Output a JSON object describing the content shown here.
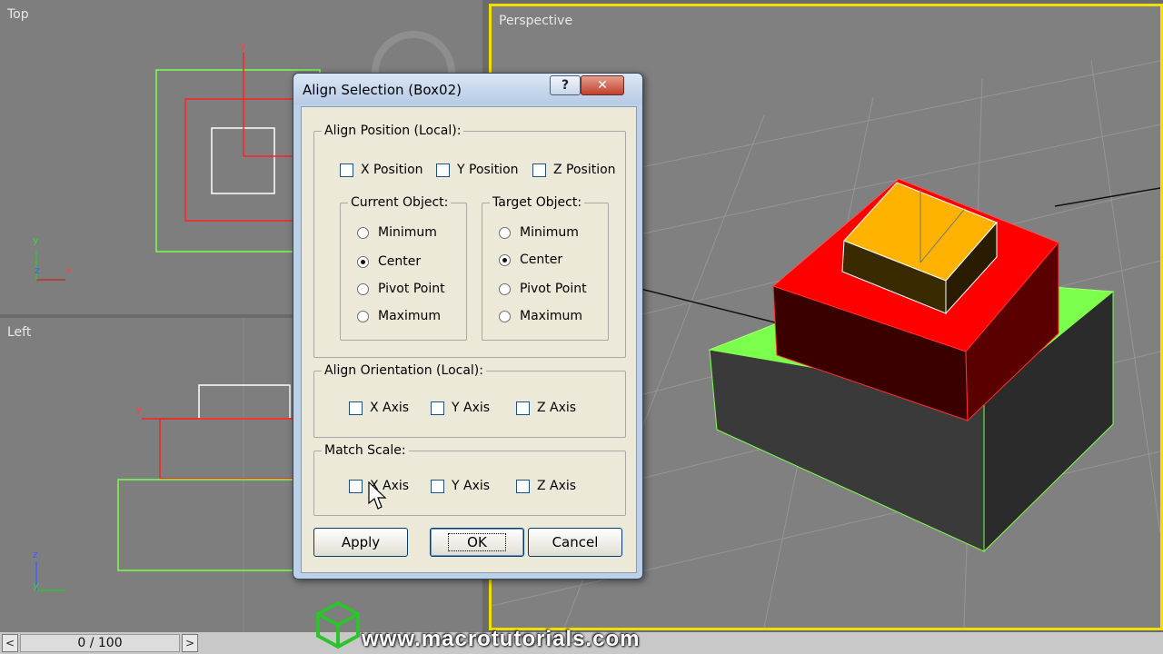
{
  "viewports": {
    "top": {
      "label": "Top"
    },
    "left": {
      "label": "Left"
    },
    "perspective": {
      "label": "Perspective"
    }
  },
  "axes": {
    "x": "x",
    "y": "y",
    "z": "z"
  },
  "timeline": {
    "position": "0 / 100",
    "prev_icon": "<",
    "next_icon": ">"
  },
  "watermark": "www.macrotutorials.com",
  "dialog": {
    "title": "Align Selection (Box02)",
    "help_label": "?",
    "close_label": "✕",
    "align_position": {
      "title": "Align Position (Local):",
      "checks": [
        "X Position",
        "Y Position",
        "Z Position"
      ],
      "current_object": {
        "title": "Current Object:",
        "options": [
          "Minimum",
          "Center",
          "Pivot Point",
          "Maximum"
        ],
        "selected": "Center"
      },
      "target_object": {
        "title": "Target Object:",
        "options": [
          "Minimum",
          "Center",
          "Pivot Point",
          "Maximum"
        ],
        "selected": "Center"
      }
    },
    "align_orientation": {
      "title": "Align Orientation (Local):",
      "checks": [
        "X Axis",
        "Y Axis",
        "Z Axis"
      ]
    },
    "match_scale": {
      "title": "Match Scale:",
      "checks": [
        "X Axis",
        "Y Axis",
        "Z Axis"
      ]
    },
    "buttons": {
      "apply": "Apply",
      "ok": "OK",
      "cancel": "Cancel"
    }
  }
}
